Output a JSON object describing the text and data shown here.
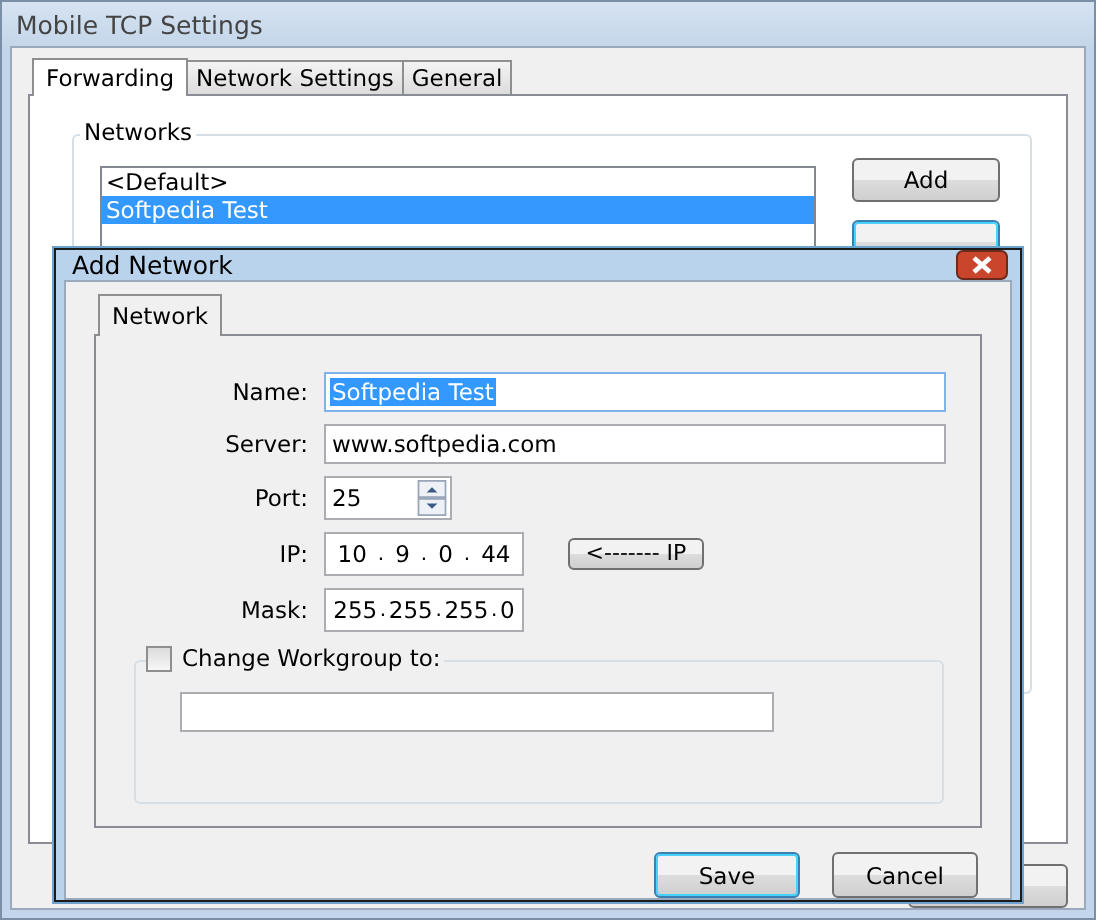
{
  "window": {
    "title": "Mobile TCP Settings"
  },
  "tabs": [
    {
      "label": "Forwarding",
      "selected": true
    },
    {
      "label": "Network Settings",
      "selected": false
    },
    {
      "label": "General",
      "selected": false
    }
  ],
  "networks": {
    "label": "Networks",
    "items": [
      {
        "text": "<Default>",
        "selected": false
      },
      {
        "text": "Softpedia Test",
        "selected": true
      }
    ],
    "buttons": [
      "Add"
    ]
  },
  "dialog": {
    "title": "Add Network",
    "tabs": [
      {
        "label": "Network",
        "selected": true
      }
    ],
    "fields": [
      {
        "label": "Name:",
        "kind": "text",
        "value": "Softpedia Test",
        "selected": true
      },
      {
        "label": "Server:",
        "kind": "text",
        "value": "www.softpedia.com",
        "selected": false
      },
      {
        "label": "Port:",
        "kind": "spin",
        "value": "25"
      },
      {
        "label": "IP:",
        "kind": "ip",
        "octets": [
          "10",
          "9",
          "0",
          "44"
        ],
        "separators": [
          ".",
          ".",
          "."
        ],
        "button": "<------- IP"
      },
      {
        "label": "Mask:",
        "kind": "ip",
        "octets": [
          "255",
          "255",
          "255",
          "0"
        ],
        "separators": [
          ".",
          ".",
          "."
        ]
      }
    ],
    "workgroup": {
      "label": "Change Workgroup to:",
      "checked": false
    },
    "buttons": [
      {
        "label": "Save",
        "default": true
      },
      {
        "label": "Cancel",
        "default": false
      }
    ]
  }
}
